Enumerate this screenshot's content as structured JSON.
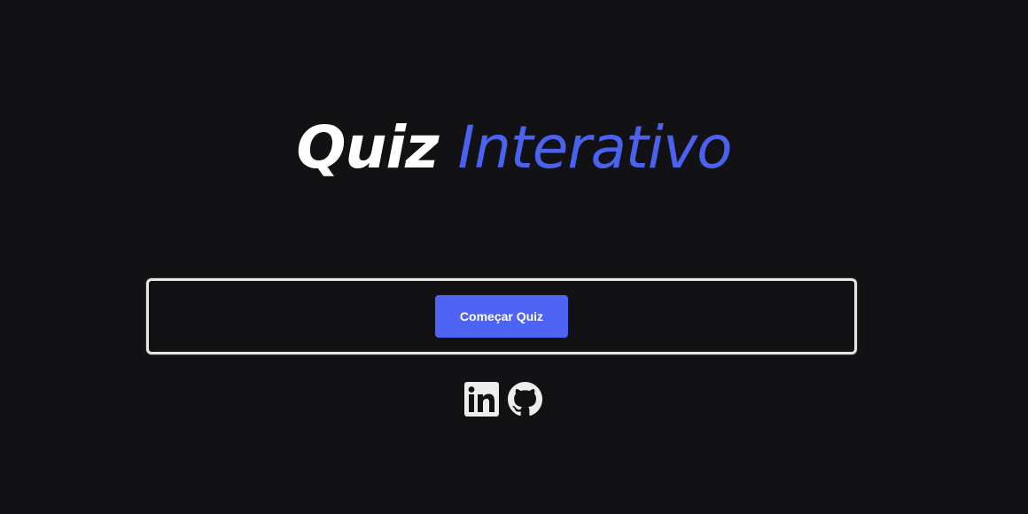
{
  "title": {
    "word1": "Quiz",
    "word2": "Interativo"
  },
  "start_button": {
    "label": "Começar Quiz"
  },
  "social": [
    {
      "icon": "linkedin-icon"
    },
    {
      "icon": "github-icon"
    }
  ],
  "colors": {
    "background": "#121214",
    "accent": "#4e63f2",
    "title_white": "#ffffff",
    "panel_border": "#e6e6e6"
  }
}
